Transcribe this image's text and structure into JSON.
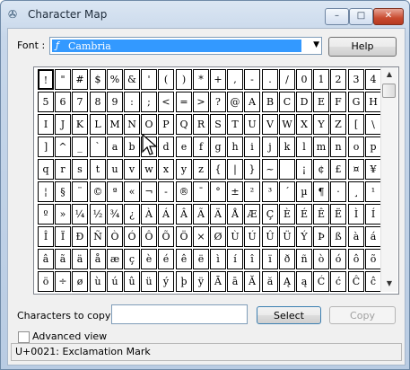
{
  "window": {
    "title": "Character Map",
    "app_icon": "✇",
    "min": "–",
    "max": "□",
    "close": "✕"
  },
  "font": {
    "label": "Font :",
    "value": "Cambria",
    "icon": "ƒ",
    "arrow": "▼"
  },
  "help_label": "Help",
  "grid": {
    "rows": [
      [
        "!",
        "\"",
        "#",
        "$",
        "%",
        "&",
        "'",
        "(",
        ")",
        "*",
        "+",
        ",",
        "-",
        ".",
        "/",
        "0",
        "1",
        "2",
        "3",
        "4"
      ],
      [
        "5",
        "6",
        "7",
        "8",
        "9",
        ":",
        ";",
        "<",
        "=",
        ">",
        "?",
        "@",
        "A",
        "B",
        "C",
        "D",
        "E",
        "F",
        "G",
        "H"
      ],
      [
        "I",
        "J",
        "K",
        "L",
        "M",
        "N",
        "O",
        "P",
        "Q",
        "R",
        "S",
        "T",
        "U",
        "V",
        "W",
        "X",
        "Y",
        "Z",
        "[",
        "\\"
      ],
      [
        "]",
        "^",
        "_",
        "`",
        "a",
        "b",
        "c",
        "d",
        "e",
        "f",
        "g",
        "h",
        "i",
        "j",
        "k",
        "l",
        "m",
        "n",
        "o",
        "p"
      ],
      [
        "q",
        "r",
        "s",
        "t",
        "u",
        "v",
        "w",
        "x",
        "y",
        "z",
        "{",
        "|",
        "}",
        "~",
        "",
        "¡",
        "¢",
        "£",
        "¤",
        "¥"
      ],
      [
        "¦",
        "§",
        "¨",
        "©",
        "ª",
        "«",
        "¬",
        "-",
        "®",
        "¯",
        "°",
        "±",
        "²",
        "³",
        "´",
        "µ",
        "¶",
        "·",
        "¸",
        "¹"
      ],
      [
        "º",
        "»",
        "¼",
        "½",
        "¾",
        "¿",
        "À",
        "Á",
        "Â",
        "Ã",
        "Ä",
        "Å",
        "Æ",
        "Ç",
        "È",
        "É",
        "Ê",
        "Ë",
        "Ì",
        "Í"
      ],
      [
        "Î",
        "Ï",
        "Ð",
        "Ñ",
        "Ò",
        "Ó",
        "Ô",
        "Õ",
        "Ö",
        "×",
        "Ø",
        "Ù",
        "Ú",
        "Û",
        "Ü",
        "Ý",
        "Þ",
        "ß",
        "à",
        "á"
      ],
      [
        "â",
        "ã",
        "ä",
        "å",
        "æ",
        "ç",
        "è",
        "é",
        "ê",
        "ë",
        "ì",
        "í",
        "î",
        "ï",
        "ð",
        "ñ",
        "ò",
        "ó",
        "ô",
        "õ"
      ],
      [
        "ö",
        "÷",
        "ø",
        "ù",
        "ú",
        "û",
        "ü",
        "ý",
        "þ",
        "ÿ",
        "Ā",
        "ā",
        "Ă",
        "ă",
        "Ą",
        "ą",
        "Ć",
        "ć",
        "Ĉ",
        "ĉ"
      ]
    ],
    "selected_index": 0
  },
  "scrollbar": {
    "up": "▲",
    "down": "▼"
  },
  "copy": {
    "label": "Characters to copy",
    "value": "",
    "select_label": "Select",
    "copy_label": "Copy"
  },
  "advanced_view_label": "Advanced view",
  "status_text": "U+0021: Exclamation Mark"
}
